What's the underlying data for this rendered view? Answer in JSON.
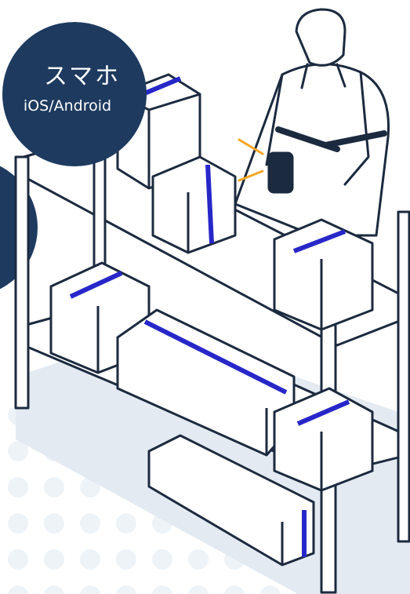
{
  "badge": {
    "title": "スマホ",
    "subtitle": "iOS/Android"
  },
  "colors": {
    "badge": "#1e3a5f",
    "outline": "#1c2a3f",
    "tape": "#2727c9",
    "scan_beam": "#f5a623",
    "shadow": "#e3eaf2",
    "dots": "#eef3f8"
  },
  "icons": [
    "fragile-glass-icon",
    "umbrella-icon",
    "this-side-up-icon",
    "barcode-label"
  ]
}
